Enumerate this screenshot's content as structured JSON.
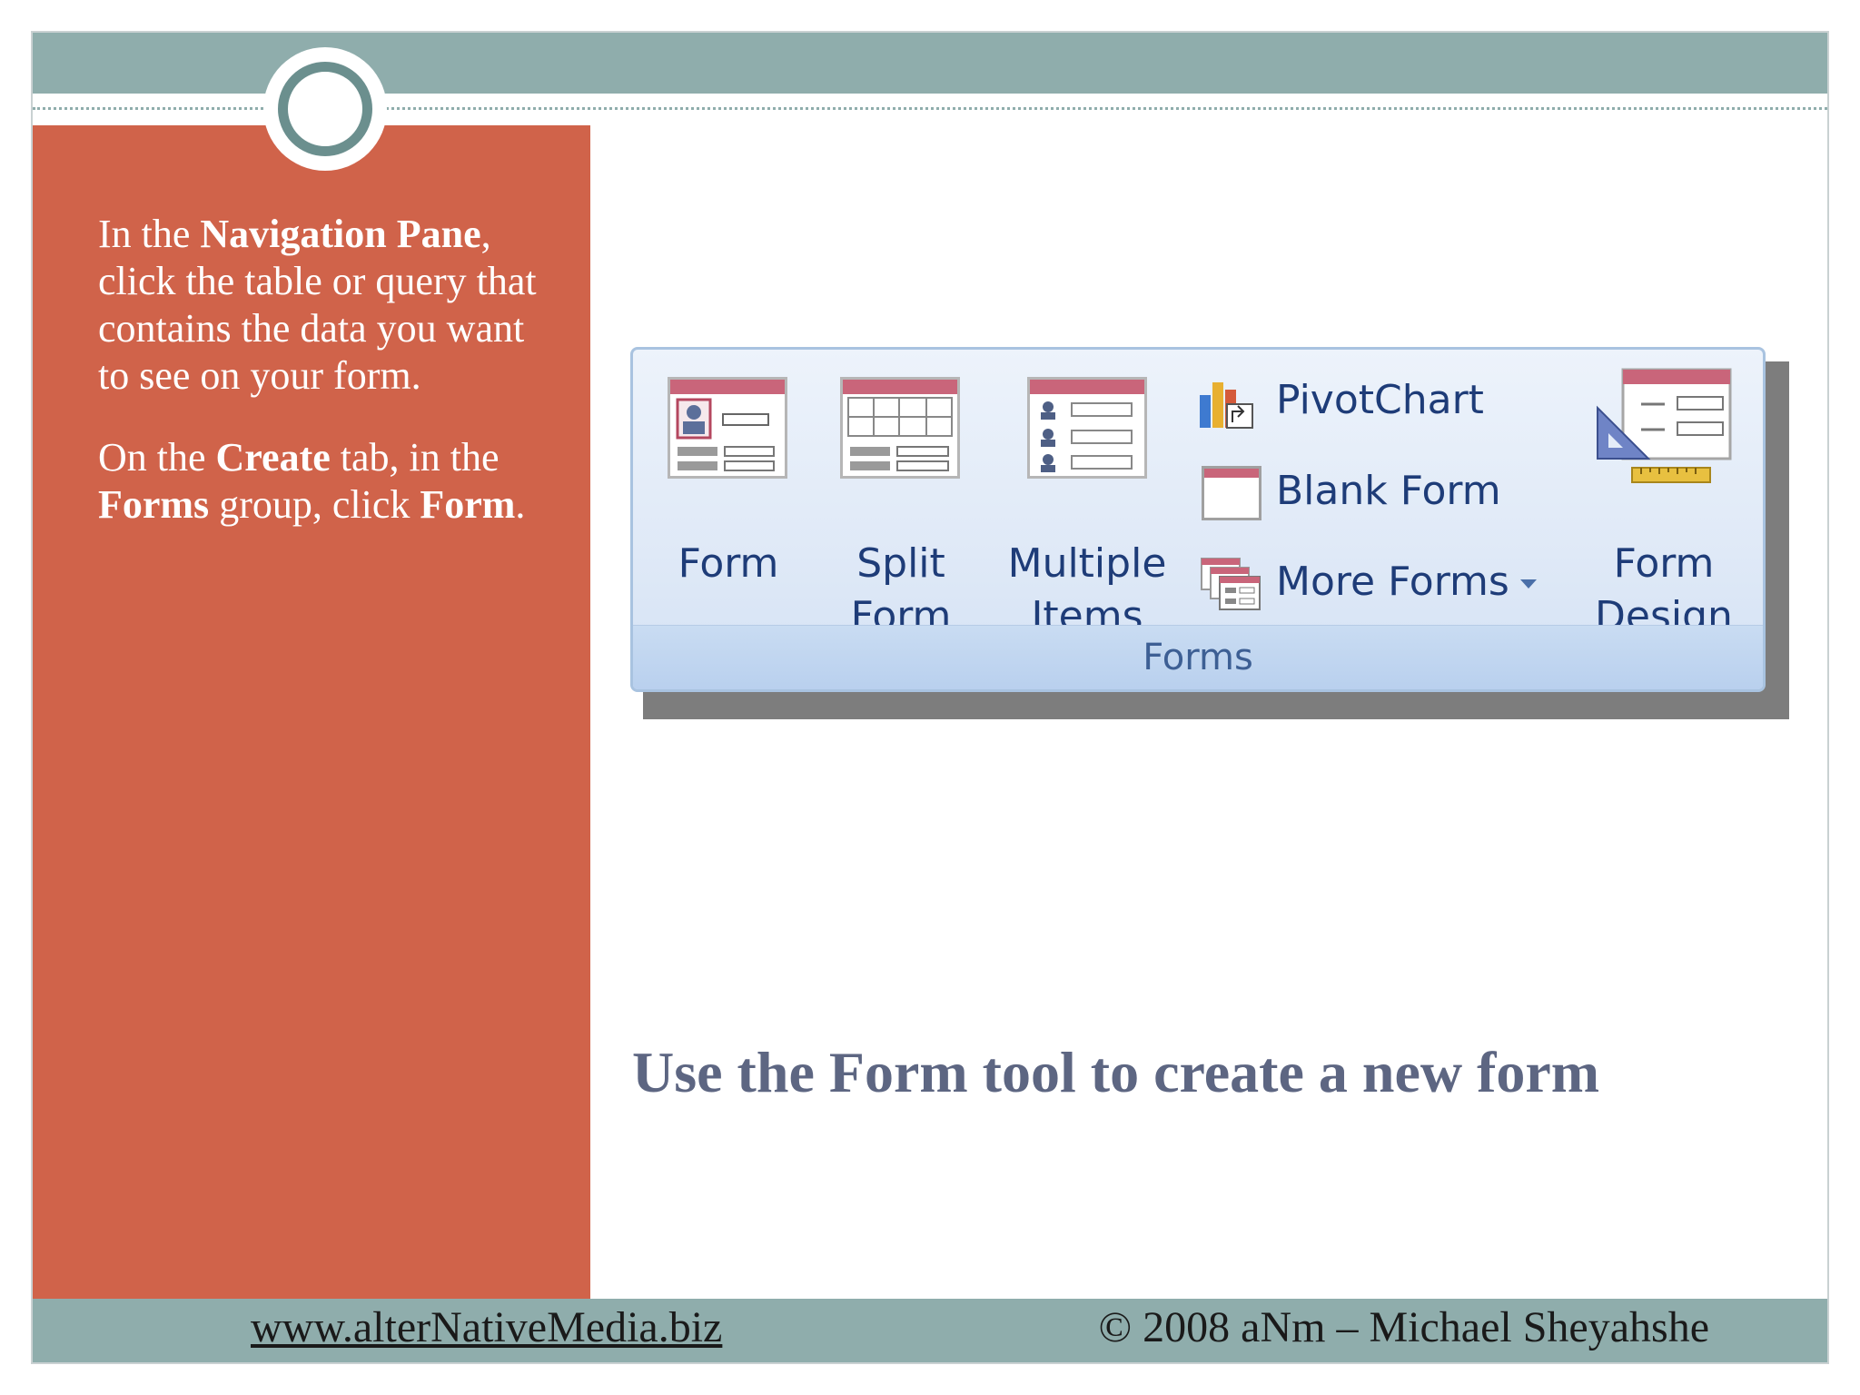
{
  "slide": {
    "instructions": {
      "p1_a": "In the ",
      "p1_b": "Navigation Pane",
      "p1_c": ", click the table or query that contains the data you want to see on your form.",
      "p2_a": "On the ",
      "p2_b": "Create",
      "p2_c": " tab, in the ",
      "p2_d": "Forms",
      "p2_e": " group, click ",
      "p2_f": "Form",
      "p2_g": "."
    },
    "caption": "Use the Form tool to create a new form",
    "footer": {
      "link": "www.alterNativeMedia.biz",
      "copyright": "© 2008 aNm – Michael Sheyahshe"
    }
  },
  "ribbon": {
    "group_label": "Forms",
    "buttons": {
      "form": "Form",
      "split_form_1": "Split",
      "split_form_2": "Form",
      "multiple_items_1": "Multiple",
      "multiple_items_2": "Items",
      "pivotchart": "PivotChart",
      "blank_form": "Blank Form",
      "more_forms": "More Forms",
      "form_design_1": "Form",
      "form_design_2": "Design"
    },
    "icons": {
      "form": "form-icon",
      "split_form": "split-form-icon",
      "multiple_items": "multiple-items-icon",
      "pivotchart": "pivotchart-icon",
      "blank_form": "blank-form-icon",
      "more_forms": "more-forms-icon",
      "form_design": "form-design-icon"
    }
  },
  "colors": {
    "left_panel": "#d0634a",
    "band": "#8fadac",
    "caption": "#5d6682",
    "ribbon_text": "#1e3c78",
    "icon_header": "#c9657a"
  }
}
